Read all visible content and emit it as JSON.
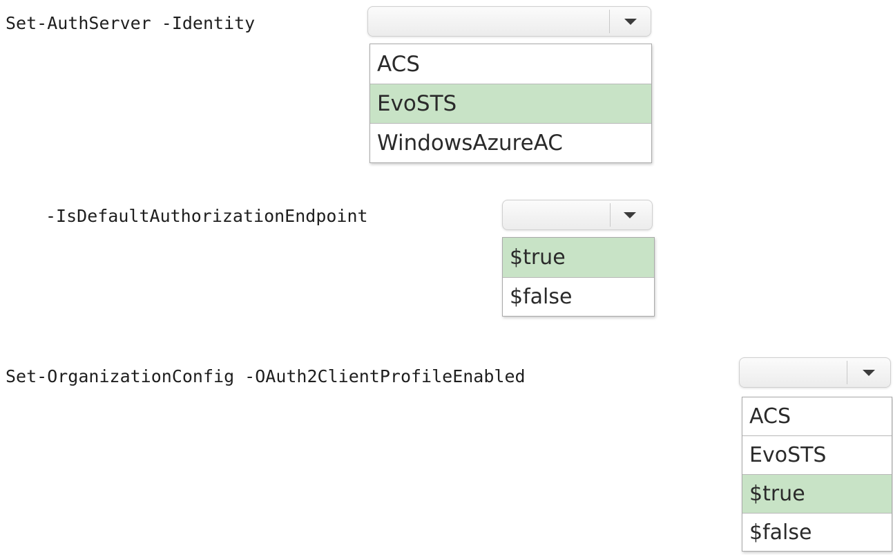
{
  "statements": [
    {
      "command": "Set-AuthServer -Identity",
      "options": [
        "ACS",
        "EvoSTS",
        "WindowsAzureAC"
      ],
      "selected": "EvoSTS"
    },
    {
      "command": "-IsDefaultAuthorizationEndpoint",
      "options": [
        "$true",
        "$false"
      ],
      "selected": "$true"
    },
    {
      "command": "Set-OrganizationConfig -OAuth2ClientProfileEnabled",
      "options": [
        "ACS",
        "EvoSTS",
        "$true",
        "$false"
      ],
      "selected": "$true"
    }
  ],
  "colors": {
    "selected_bg": "#c8e3c6",
    "text": "#1e1e1e"
  }
}
